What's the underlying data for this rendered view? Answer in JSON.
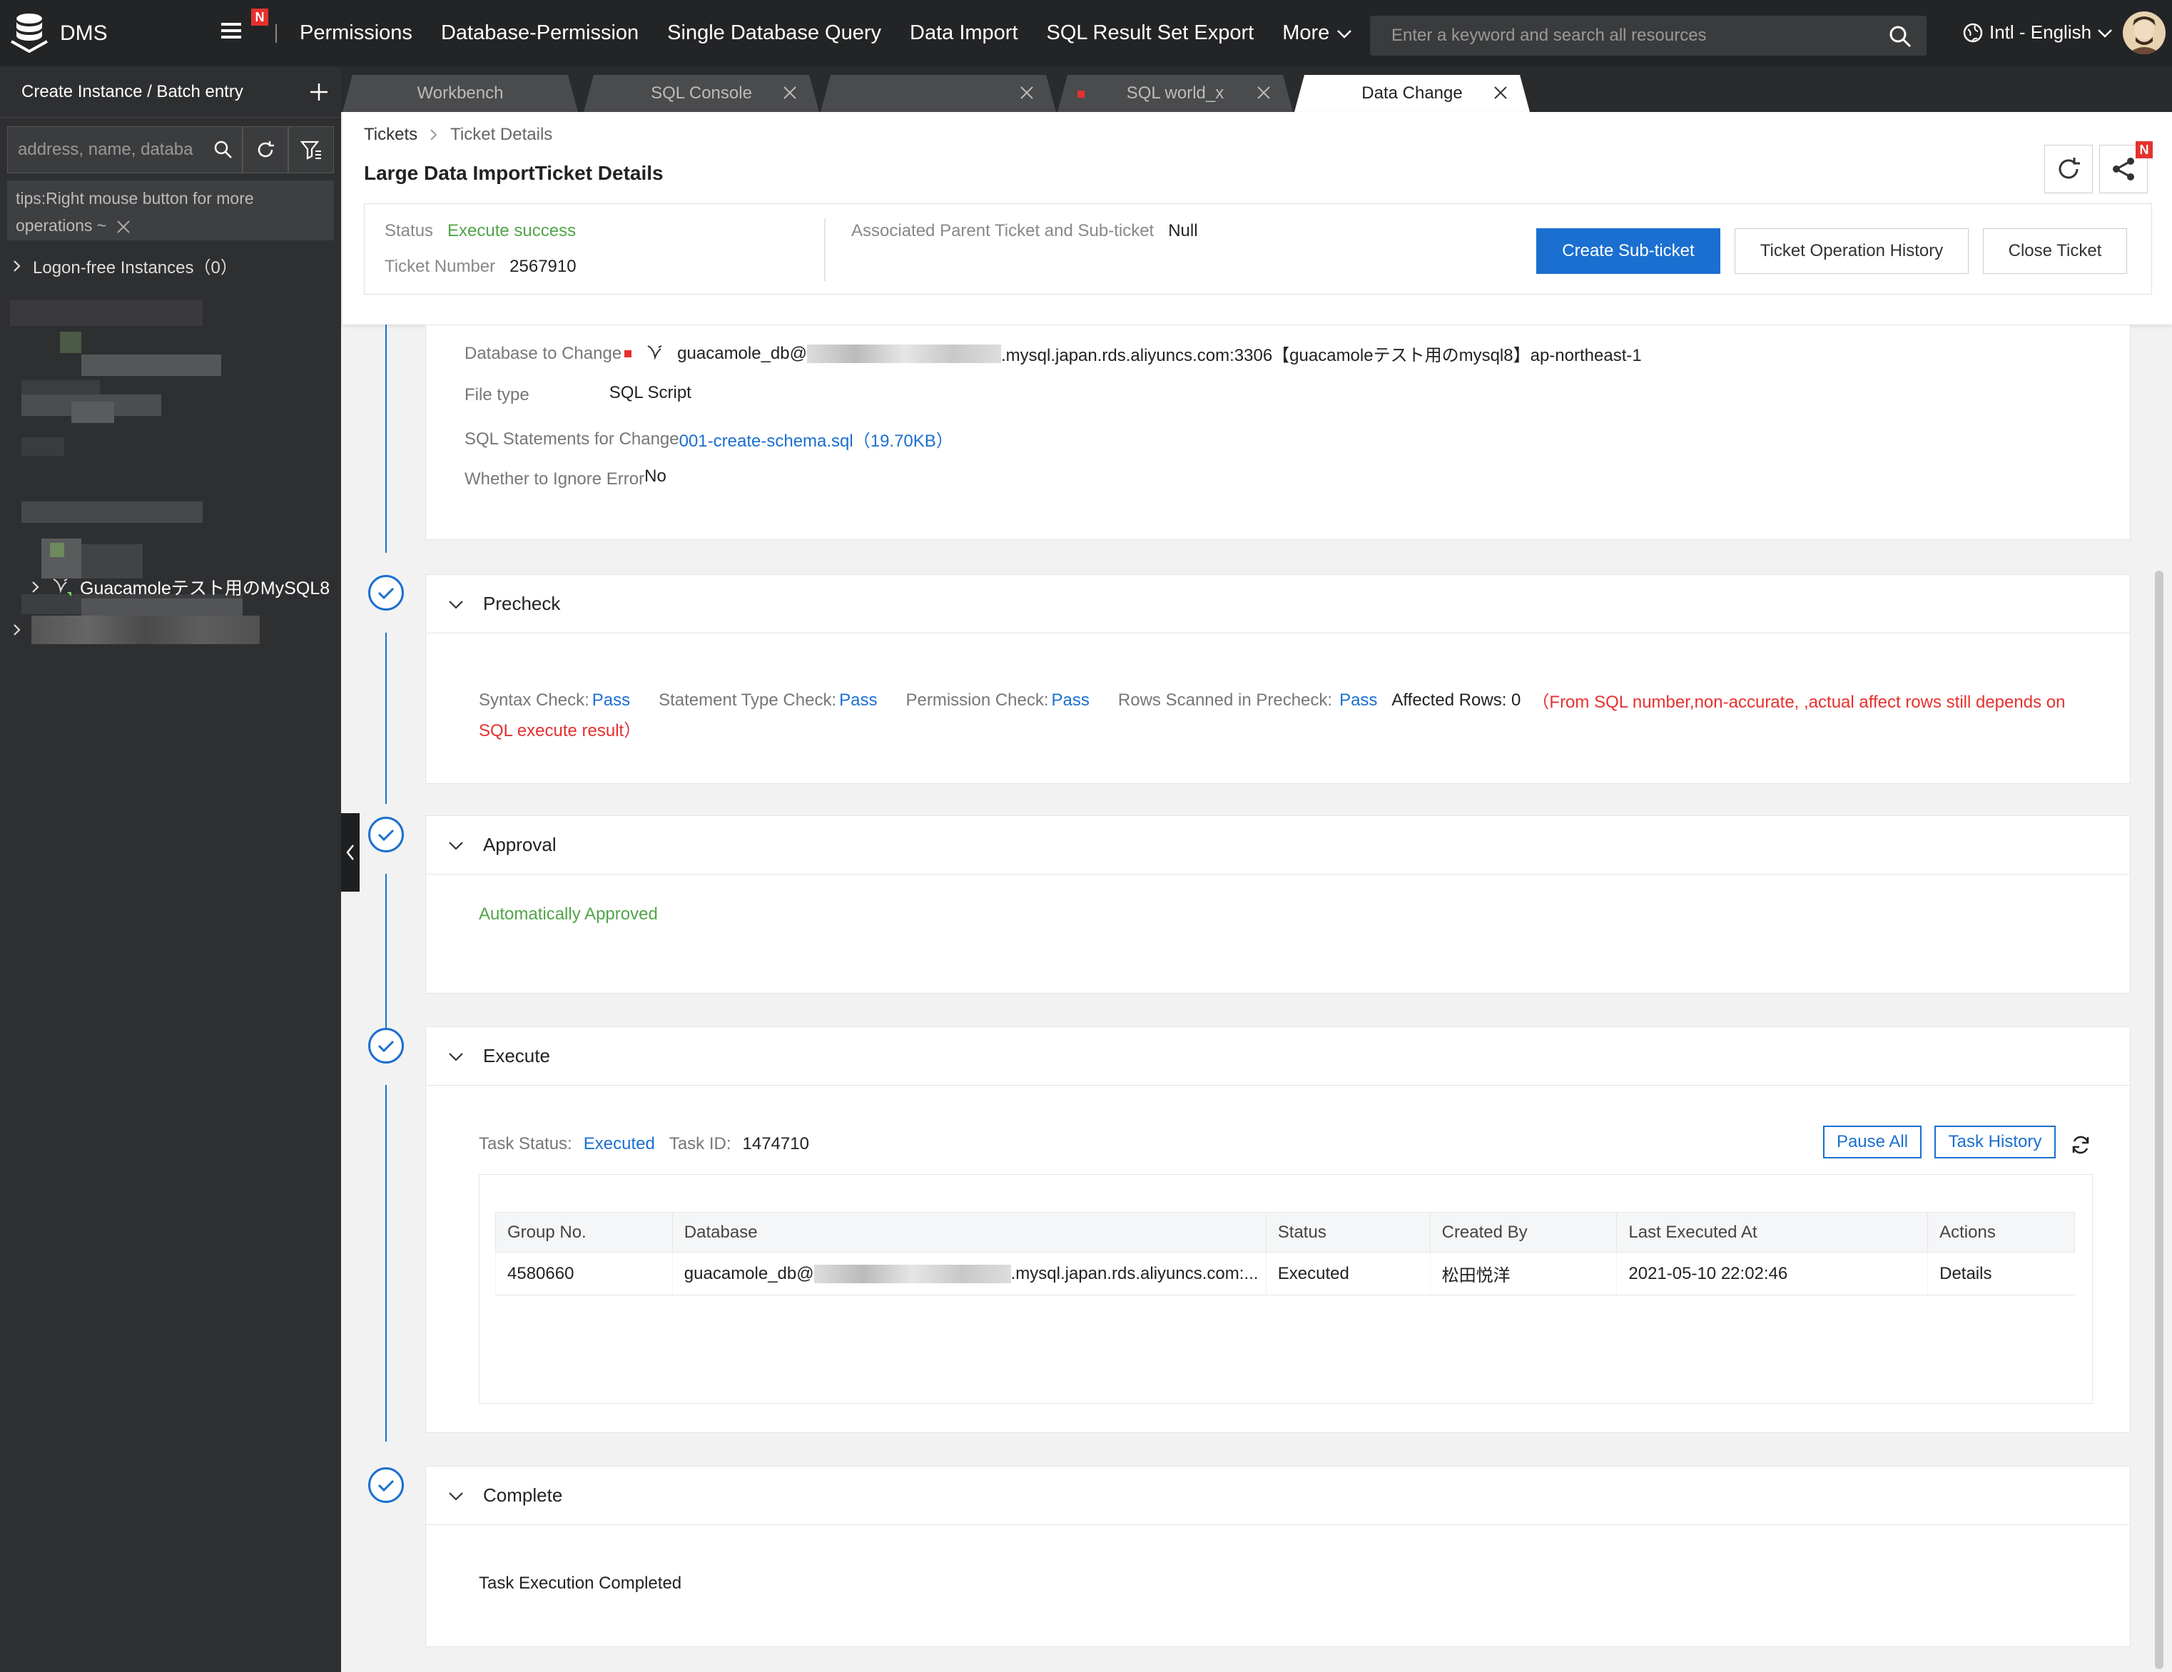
{
  "app": {
    "name": "DMS"
  },
  "nav": {
    "items": [
      "Permissions",
      "Database-Permission",
      "Single Database Query",
      "Data Import",
      "SQL Result Set Export"
    ],
    "more_label": "More",
    "badge": "N",
    "search_placeholder": "Enter a keyword and search all resources",
    "language": "Intl - English"
  },
  "sidebar": {
    "title": "Create Instance / Batch entry",
    "search_placeholder": "address, name, databa",
    "tips": "tips:Right mouse button for more operations ~",
    "logon_free": "Logon-free Instances（0）",
    "instance": "Guacamoleテスト用のMySQL8"
  },
  "tabs": [
    {
      "label": "Workbench"
    },
    {
      "label": "SQL Console"
    },
    {
      "label": ""
    },
    {
      "label": "SQL world_x"
    },
    {
      "label": "Data Change"
    }
  ],
  "header": {
    "breadcrumb": {
      "root": "Tickets",
      "current": "Ticket Details"
    },
    "title": "Large Data ImportTicket Details",
    "status_label": "Status",
    "status_value": "Execute success",
    "ticket_number_label": "Ticket Number",
    "ticket_number": "2567910",
    "parent_label": "Associated Parent Ticket and Sub-ticket",
    "parent_value": "Null",
    "share_badge": "N",
    "buttons": {
      "create_sub": "Create Sub-ticket",
      "history": "Ticket Operation History",
      "close": "Close Ticket"
    }
  },
  "details": {
    "db_label": "Database to Change",
    "db_prefix": "guacamole_db@",
    "db_suffix": ".mysql.japan.rds.aliyuncs.com:3306【guacamoleテスト用のmysql8】ap-northeast-1",
    "file_type_label": "File type",
    "file_type": "SQL Script",
    "sql_label": "SQL Statements for Change",
    "sql_file": "001-create-schema.sql（19.70KB）",
    "ignore_label": "Whether to Ignore Error",
    "ignore_value": "No"
  },
  "precheck": {
    "title": "Precheck",
    "syntax_label": "Syntax Check:",
    "syntax_value": "Pass",
    "type_label": "Statement Type Check:",
    "type_value": "Pass",
    "perm_label": "Permission Check:",
    "perm_value": "Pass",
    "rows_label": "Rows Scanned in Precheck:",
    "rows_value": "Pass",
    "affected": "Affected Rows: 0",
    "note_line1": "（From SQL number,non-accurate, ,actual affect rows still depends on",
    "note_line2": "SQL execute result）"
  },
  "approval": {
    "title": "Approval",
    "text": "Automatically Approved"
  },
  "execute": {
    "title": "Execute",
    "task_status_label": "Task Status:",
    "task_status": "Executed",
    "task_id_label": "Task ID:",
    "task_id": "1474710",
    "pause_all": "Pause All",
    "task_history": "Task History",
    "columns": [
      "Group No.",
      "Database",
      "Status",
      "Created By",
      "Last Executed At",
      "Actions"
    ],
    "row": {
      "group": "4580660",
      "db_prefix": "guacamole_db@",
      "db_suffix": ".mysql.japan.rds.aliyuncs.com:...",
      "status": "Executed",
      "created_by": "松田悦洋",
      "last_executed": "2021-05-10 22:02:46",
      "action": "Details"
    }
  },
  "complete": {
    "title": "Complete",
    "text": "Task Execution Completed"
  }
}
